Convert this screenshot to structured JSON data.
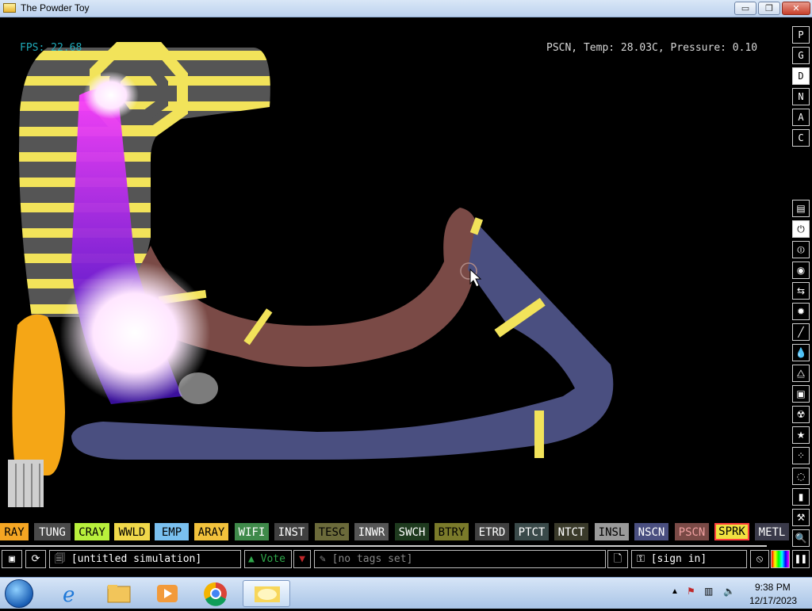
{
  "window": {
    "title": "The Powder Toy",
    "controls": {
      "minimize": "▭",
      "maximize": "❐",
      "close": "✕"
    }
  },
  "hud": {
    "fps": "FPS: 22.68",
    "info": "PSCN, Temp: 28.03C, Pressure: 0.10"
  },
  "right_menu": {
    "top_buttons": [
      "P",
      "G",
      "D",
      "N",
      "A",
      "C"
    ],
    "active_top": "D",
    "categories": [
      {
        "icon": "▤",
        "name": "walls-icon"
      },
      {
        "icon": "⏻",
        "name": "electronics-icon"
      },
      {
        "icon": "⏼",
        "name": "powered-icon"
      },
      {
        "icon": "◉",
        "name": "sensors-icon"
      },
      {
        "icon": "⇆",
        "name": "force-icon"
      },
      {
        "icon": "✹",
        "name": "explosives-icon"
      },
      {
        "icon": "╱",
        "name": "gases-icon"
      },
      {
        "icon": "💧",
        "name": "liquids-icon"
      },
      {
        "icon": "⧋",
        "name": "powders-icon"
      },
      {
        "icon": "▣",
        "name": "solids-icon"
      },
      {
        "icon": "☢",
        "name": "radioactive-icon"
      },
      {
        "icon": "★",
        "name": "special-icon"
      },
      {
        "icon": "⁘",
        "name": "life-icon"
      },
      {
        "icon": "◌",
        "name": "tools-icon"
      },
      {
        "icon": "▮",
        "name": "favorites-icon"
      },
      {
        "icon": "⚒",
        "name": "decoration-icon"
      },
      {
        "icon": "🔍",
        "name": "search-icon"
      }
    ],
    "active_category": "electronics-icon"
  },
  "elements": [
    {
      "label": "RAY",
      "bg": "#f5a623",
      "fg": "#000000"
    },
    {
      "label": "TUNG",
      "bg": "#4a4a4a",
      "fg": "#ffffff"
    },
    {
      "label": "CRAY",
      "bg": "#b8f03c",
      "fg": "#000000"
    },
    {
      "label": "WWLD",
      "bg": "#f0d84a",
      "fg": "#000000"
    },
    {
      "label": "EMP",
      "bg": "#7ac0f0",
      "fg": "#000000"
    },
    {
      "label": "ARAY",
      "bg": "#f2c23c",
      "fg": "#000000"
    },
    {
      "label": "WIFI",
      "bg": "#3f8a4a",
      "fg": "#ffffff"
    },
    {
      "label": "INST",
      "bg": "#404040",
      "fg": "#ffffff"
    },
    {
      "label": "TESC",
      "bg": "#6b6a3a",
      "fg": "#000000"
    },
    {
      "label": "INWR",
      "bg": "#555555",
      "fg": "#ffffff"
    },
    {
      "label": "SWCH",
      "bg": "#1e3a1e",
      "fg": "#ffffff"
    },
    {
      "label": "BTRY",
      "bg": "#7a7a2a",
      "fg": "#000000"
    },
    {
      "label": "ETRD",
      "bg": "#404040",
      "fg": "#ffffff"
    },
    {
      "label": "PTCT",
      "bg": "#3a4a4a",
      "fg": "#ffffff"
    },
    {
      "label": "NTCT",
      "bg": "#3a3a2a",
      "fg": "#ffffff"
    },
    {
      "label": "INSL",
      "bg": "#9a9a9a",
      "fg": "#000000"
    },
    {
      "label": "NSCN",
      "bg": "#4a4f80",
      "fg": "#ffffff"
    },
    {
      "label": "PSCN",
      "bg": "#7a4a46",
      "fg": "#f0a0a0"
    },
    {
      "label": "SPRK",
      "bg": "#f0e040",
      "fg": "#000000",
      "selected": true
    },
    {
      "label": "METL",
      "bg": "#3a3a4a",
      "fg": "#ffffff"
    }
  ],
  "bottom_bar": {
    "save_icon": "▣",
    "reload_icon": "⟳",
    "sim_title": "[untitled simulation]",
    "vote_label": "Vote",
    "vote_up_icon": "▲",
    "vote_down_icon": "▼",
    "tags_text": "[no tags set]",
    "sign_in_text": "[sign in]",
    "pause_icon": "❚❚"
  },
  "taskbar": {
    "apps": [
      {
        "name": "internet-explorer-icon",
        "glyph": "e"
      },
      {
        "name": "file-explorer-icon",
        "glyph": "▤"
      },
      {
        "name": "media-player-icon",
        "glyph": "▶"
      },
      {
        "name": "chrome-icon",
        "glyph": "◎"
      },
      {
        "name": "powder-toy-taskbar-icon",
        "glyph": "▬"
      }
    ],
    "time": "9:38 PM",
    "date": "12/17/2023"
  }
}
